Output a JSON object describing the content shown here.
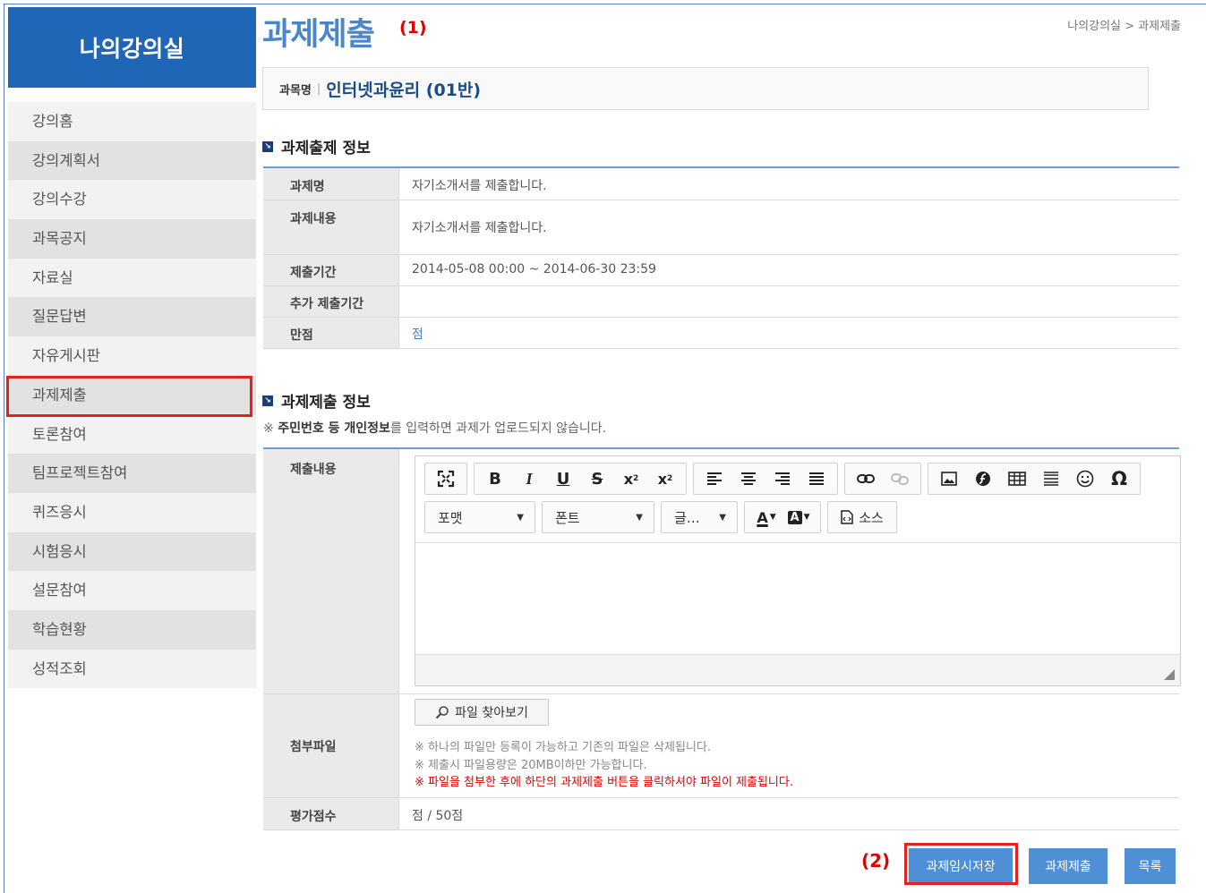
{
  "sidebar": {
    "title": "나의강의실",
    "items": [
      {
        "label": "강의홈"
      },
      {
        "label": "강의계획서"
      },
      {
        "label": "강의수강"
      },
      {
        "label": "과목공지"
      },
      {
        "label": "자료실"
      },
      {
        "label": "질문답변"
      },
      {
        "label": "자유게시판"
      },
      {
        "label": "과제제출"
      },
      {
        "label": "토론참여"
      },
      {
        "label": "팀프로젝트참여"
      },
      {
        "label": "퀴즈응시"
      },
      {
        "label": "시험응시"
      },
      {
        "label": "설문참여"
      },
      {
        "label": "학습현황"
      },
      {
        "label": "성적조회"
      }
    ],
    "highlight_color": "#e6201f"
  },
  "header": {
    "title": "과제제출",
    "title_marker": "(1)",
    "breadcrumb": "나의강의실 > 과제제출"
  },
  "course": {
    "label": "과목명",
    "separator": "|",
    "name": "인터넷과윤리 (01반)"
  },
  "assignment_info": {
    "section_title": "과제출제 정보",
    "rows": [
      {
        "label": "과제명",
        "value": "자기소개서를 제출합니다."
      },
      {
        "label": "과제내용",
        "value": "자기소개서를 제출합니다."
      },
      {
        "label": "제출기간",
        "value": "2014-05-08 00:00 ~ 2014-06-30 23:59"
      },
      {
        "label": "추가 제출기간",
        "value": ""
      },
      {
        "label": "만점",
        "value": "점"
      }
    ]
  },
  "submission": {
    "section_title": "과제제출 정보",
    "notice_prefix": "※ ",
    "notice_bold1": "주민번호 등 개인정보",
    "notice_rest": "를 입력하면 과제가 업로드되지 않습니다.",
    "content_label": "제출내용",
    "editor": {
      "format_label": "포맷",
      "font_label": "폰트",
      "size_label": "글…",
      "source_label": "소스"
    },
    "attach_label": "첨부파일",
    "file_button": "파일 찾아보기",
    "file_notes": [
      "※ 하나의 파일만 등록이 가능하고 기존의 파일은 삭제됩니다.",
      "※ 제출시 파일용량은 20MB이하만 가능합니다."
    ],
    "file_warning": "※ 파일을 첨부한 후에 하단의 과제제출 버튼을 클릭하셔야 파일이 제출됩니다.",
    "score_label": "평가점수",
    "score_value": "점 / 50점"
  },
  "buttons": {
    "marker": "(2)",
    "temp_save": "과제임시저장",
    "submit": "과제제출",
    "list": "목록"
  }
}
